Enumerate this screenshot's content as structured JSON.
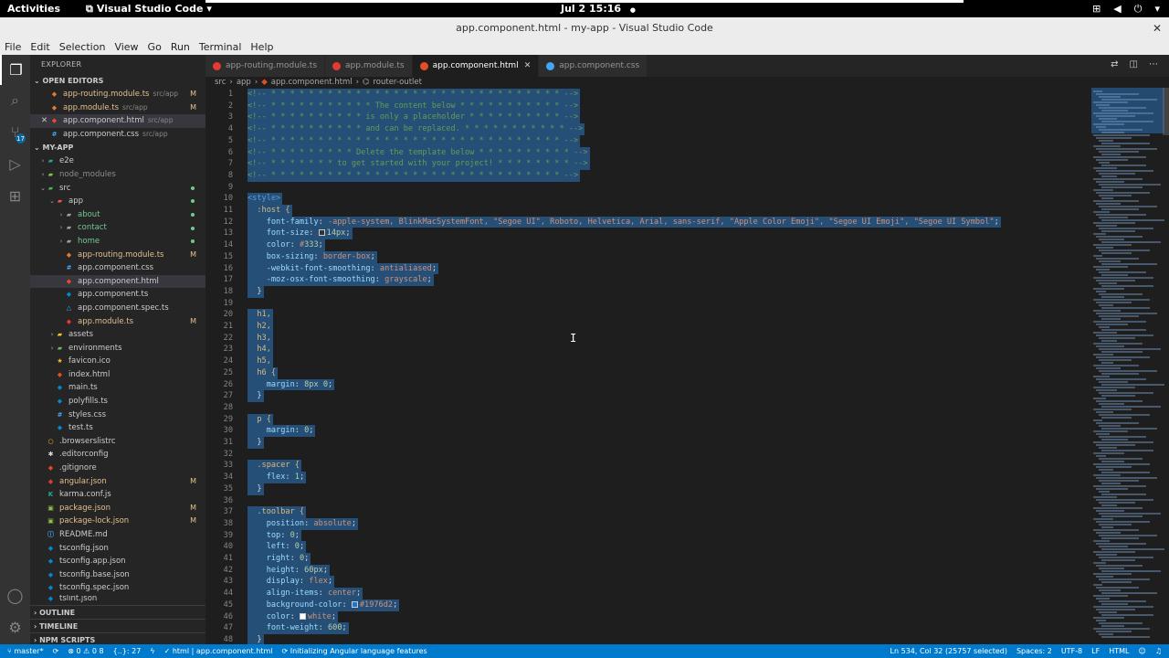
{
  "gnome": {
    "activities": "Activities",
    "app_name": "Visual Studio Code",
    "clock": "Jul 2  15:16"
  },
  "window": {
    "title": "app.component.html - my-app - Visual Studio Code"
  },
  "menu": [
    "File",
    "Edit",
    "Selection",
    "View",
    "Go",
    "Run",
    "Terminal",
    "Help"
  ],
  "activity_bar": {
    "scm_badge": "17"
  },
  "sidebar": {
    "title": "EXPLORER",
    "open_editors_label": "OPEN EDITORS",
    "open_editors": [
      {
        "name": "app-routing.module.ts",
        "path": "src/app",
        "status": "M"
      },
      {
        "name": "app.module.ts",
        "path": "src/app",
        "status": "M"
      },
      {
        "name": "app.component.html",
        "path": "src/app",
        "status": ""
      },
      {
        "name": "app.component.css",
        "path": "src/app",
        "status": ""
      }
    ],
    "project_label": "MY-APP",
    "tree": [
      {
        "name": "e2e",
        "status": ""
      },
      {
        "name": "node_modules",
        "status": ""
      },
      {
        "name": "src",
        "status": ""
      },
      {
        "name": "app",
        "status": ""
      },
      {
        "name": "about",
        "status": ""
      },
      {
        "name": "contact",
        "status": ""
      },
      {
        "name": "home",
        "status": ""
      },
      {
        "name": "app-routing.module.ts",
        "status": "M"
      },
      {
        "name": "app.component.css",
        "status": ""
      },
      {
        "name": "app.component.html",
        "status": ""
      },
      {
        "name": "app.component.ts",
        "status": ""
      },
      {
        "name": "app.component.spec.ts",
        "status": ""
      },
      {
        "name": "app.module.ts",
        "status": "M"
      },
      {
        "name": "assets",
        "status": ""
      },
      {
        "name": "environments",
        "status": ""
      },
      {
        "name": "favicon.ico",
        "status": ""
      },
      {
        "name": "index.html",
        "status": ""
      },
      {
        "name": "main.ts",
        "status": ""
      },
      {
        "name": "polyfills.ts",
        "status": ""
      },
      {
        "name": "styles.css",
        "status": ""
      },
      {
        "name": "test.ts",
        "status": ""
      },
      {
        "name": ".browserslistrc",
        "status": ""
      },
      {
        "name": ".editorconfig",
        "status": ""
      },
      {
        "name": ".gitignore",
        "status": ""
      },
      {
        "name": "angular.json",
        "status": "M"
      },
      {
        "name": "karma.conf.js",
        "status": ""
      },
      {
        "name": "package.json",
        "status": "M"
      },
      {
        "name": "package-lock.json",
        "status": "M"
      },
      {
        "name": "README.md",
        "status": ""
      },
      {
        "name": "tsconfig.json",
        "status": ""
      },
      {
        "name": "tsconfig.app.json",
        "status": ""
      },
      {
        "name": "tsconfig.base.json",
        "status": ""
      },
      {
        "name": "tsconfig.spec.json",
        "status": ""
      },
      {
        "name": "tslint.json",
        "status": ""
      }
    ],
    "outline_label": "OUTLINE",
    "timeline_label": "TIMELINE",
    "npm_label": "NPM SCRIPTS"
  },
  "tabs": [
    {
      "label": "app-routing.module.ts"
    },
    {
      "label": "app.module.ts"
    },
    {
      "label": "app.component.html"
    },
    {
      "label": "app.component.css"
    }
  ],
  "breadcrumb": [
    "src",
    "app",
    "app.component.html",
    "router-outlet"
  ],
  "code_lines": [
    "<!-- * * * * * * * * * * * * * * * * * * * * * * * * * * * * * * * -->",
    "<!-- * * * * * * * * * * * The content below * * * * * * * * * * * -->",
    "<!-- * * * * * * * * * * is only a placeholder * * * * * * * * * * -->",
    "<!-- * * * * * * * * * * and can be replaced. * * * * * * * * * * * -->",
    "<!-- * * * * * * * * * * * * * * * * * * * * * * * * * * * * * * * -->",
    "<!-- * * * * * * * * * Delete the template below * * * * * * * * * * -->",
    "<!-- * * * * * * * to get started with your project! * * * * * * * * -->",
    "<!-- * * * * * * * * * * * * * * * * * * * * * * * * * * * * * * * -->",
    "",
    "<style>",
    "  :host {",
    "    font-family: -apple-system, BlinkMacSystemFont, \"Segoe UI\", Roboto, Helvetica, Arial, sans-serif, \"Apple Color Emoji\", \"Segoe UI Emoji\", \"Segoe UI Symbol\";",
    "    font-size: 14px;",
    "    color: #333;",
    "    box-sizing: border-box;",
    "    -webkit-font-smoothing: antialiased;",
    "    -moz-osx-font-smoothing: grayscale;",
    "  }",
    "",
    "  h1,",
    "  h2,",
    "  h3,",
    "  h4,",
    "  h5,",
    "  h6 {",
    "    margin: 8px 0;",
    "  }",
    "",
    "  p {",
    "    margin: 0;",
    "  }",
    "",
    "  .spacer {",
    "    flex: 1;",
    "  }",
    "",
    "  .toolbar {",
    "    position: absolute;",
    "    top: 0;",
    "    left: 0;",
    "    right: 0;",
    "    height: 60px;",
    "    display: flex;",
    "    align-items: center;",
    "    background-color: #1976d2;",
    "    color: white;",
    "    font-weight: 600;",
    "  }"
  ],
  "swatches": {
    "12": "#333333",
    "44": "#1976d2",
    "45": "#ffffff"
  },
  "status": {
    "branch": "master*",
    "problems": "⊗ 0  ⚠ 0  8",
    "brackets": "{..}: 27",
    "language_item": "html | app.component.html",
    "message": "Initializing Angular language features",
    "position": "Ln 534, Col 32 (25757 selected)",
    "spaces": "Spaces: 2",
    "encoding": "UTF-8",
    "eol": "LF",
    "language": "HTML"
  },
  "colors": {
    "accent": "#007acc",
    "selection": "#264f78",
    "modified": "#e2c08d"
  }
}
